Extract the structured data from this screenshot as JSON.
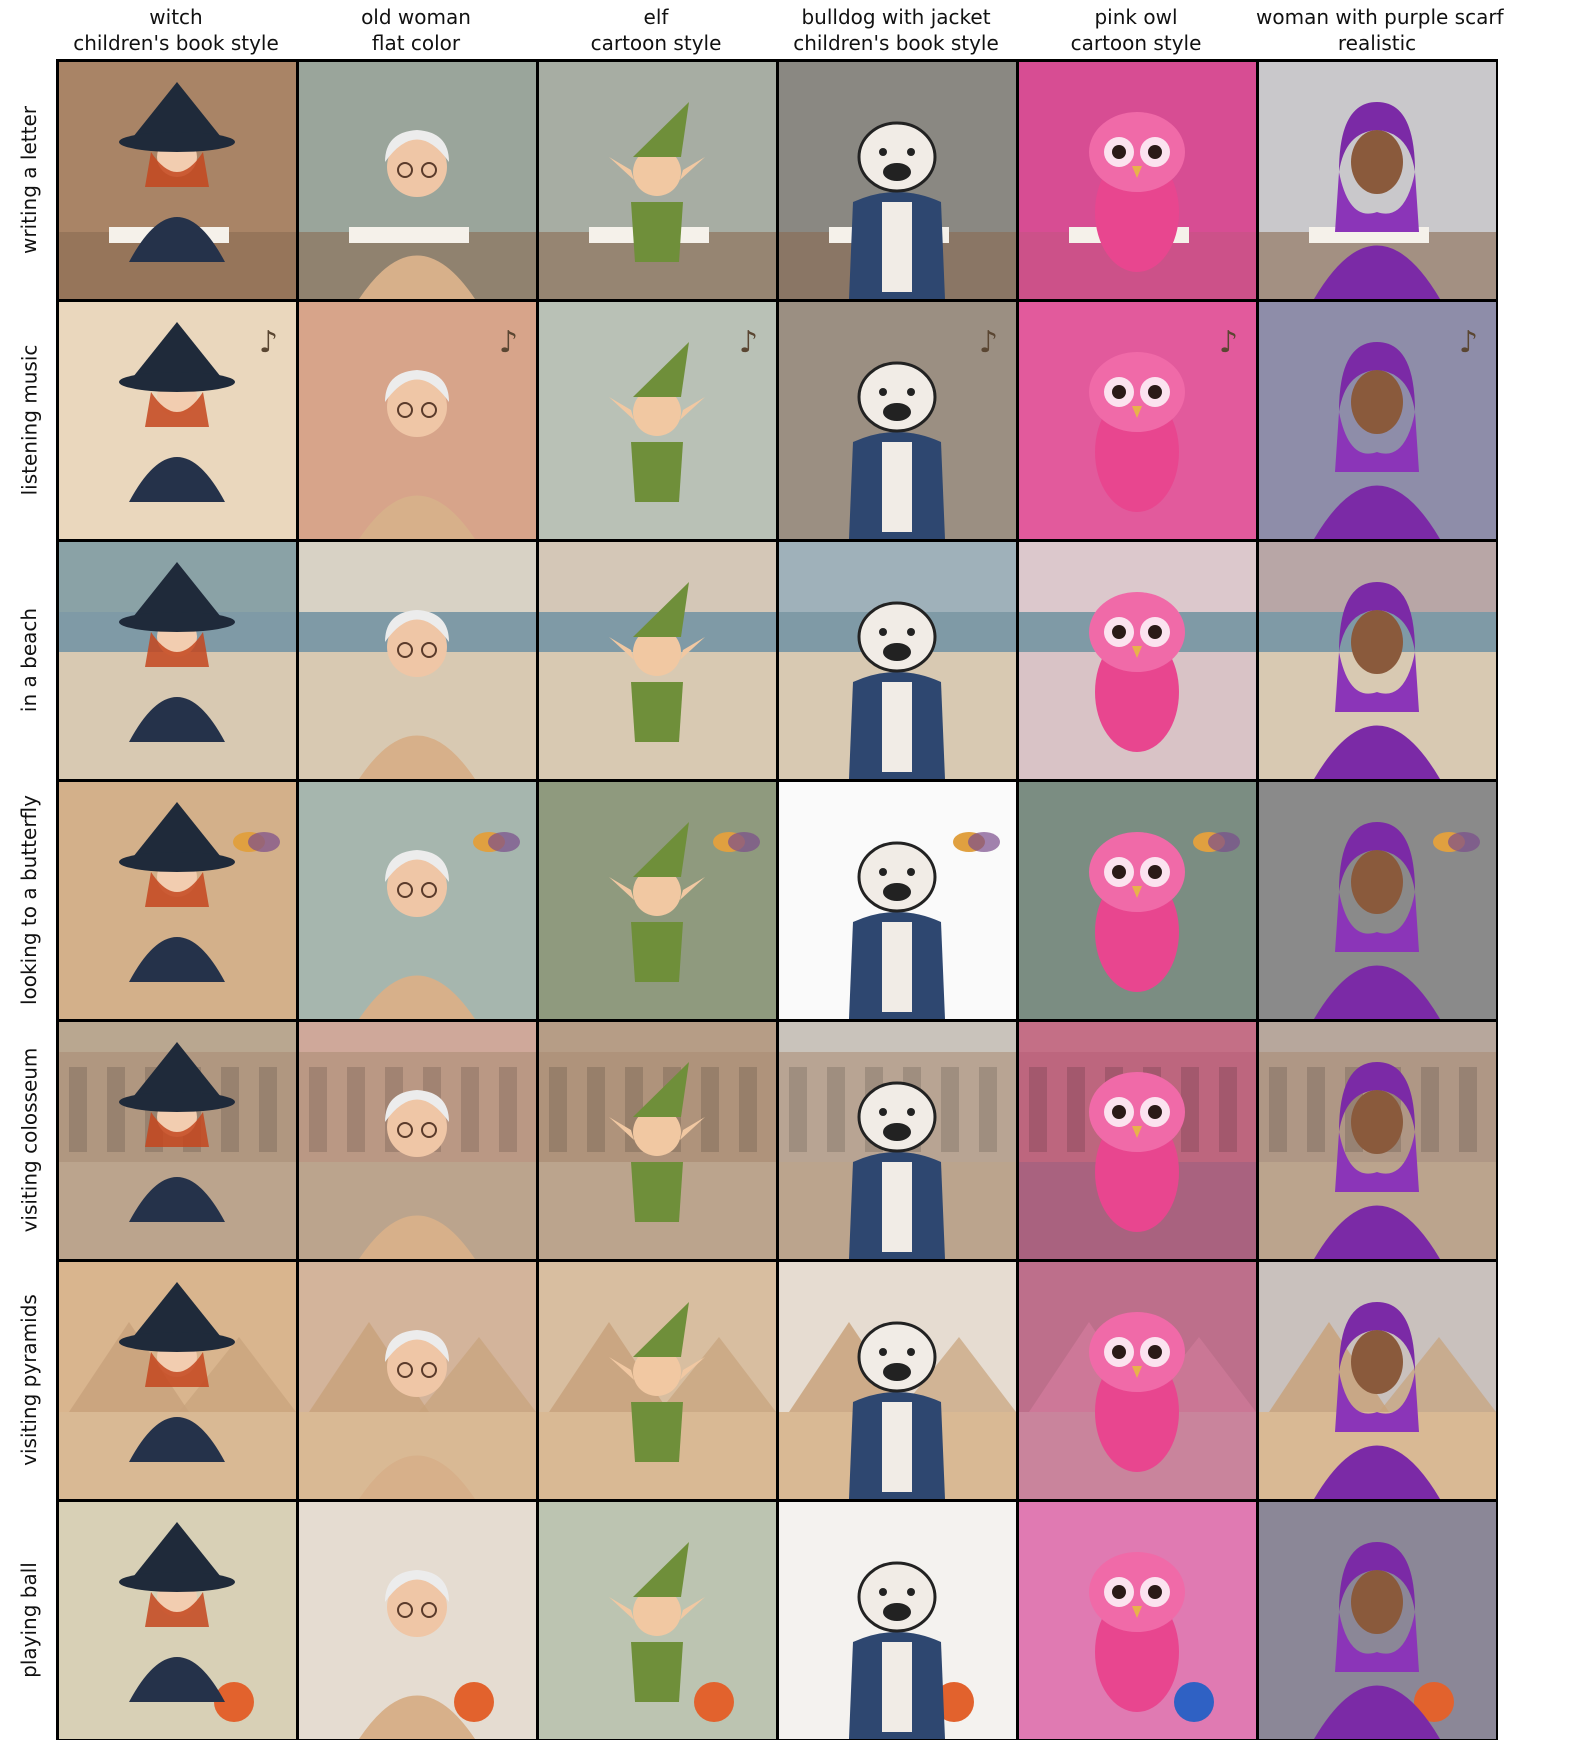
{
  "columns": [
    {
      "subject": "witch",
      "style": "children's book style"
    },
    {
      "subject": "old woman",
      "style": "flat color"
    },
    {
      "subject": "elf",
      "style": "cartoon style"
    },
    {
      "subject": "bulldog with jacket",
      "style": "children's book style"
    },
    {
      "subject": "pink owl",
      "style": "cartoon style"
    },
    {
      "subject": "woman with purple scarf",
      "style": "realistic"
    }
  ],
  "rows": [
    {
      "label": "writing a letter"
    },
    {
      "label": "listening music"
    },
    {
      "label": "in a beach"
    },
    {
      "label": "looking to a butterfly"
    },
    {
      "label": "visiting colosseum"
    },
    {
      "label": "visiting pyramids"
    },
    {
      "label": "playing ball"
    }
  ],
  "palette": {
    "witch_hat": "#1f2a3a",
    "witch_hair": "#c4471f",
    "old_woman_hair": "#ececec",
    "old_woman_cloth": "#d7b08a",
    "elf_green": "#6f8f3a",
    "elf_skin": "#f1c8a2",
    "bulldog_jacket": "#2e4770",
    "bulldog_fur": "#f1ece6",
    "owl_pink": "#e8468f",
    "scarf_purple": "#7b2aa6",
    "woman_skin": "#8a5a3c"
  }
}
